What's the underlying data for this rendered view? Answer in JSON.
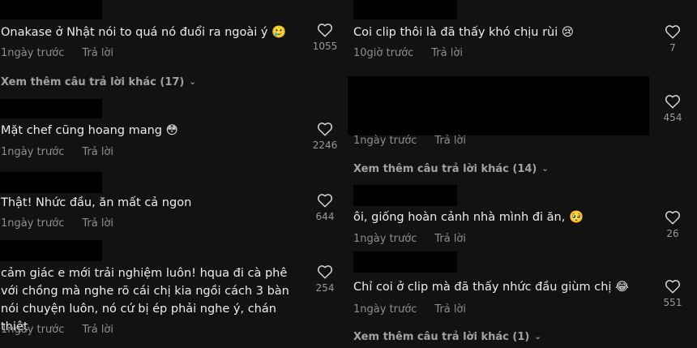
{
  "left_column": {
    "comments": [
      {
        "text": "Onakase ở Nhật nói to quá nó đuổi ra ngoài ý 🥲",
        "time": "1ngày trước",
        "reply": "Trả lời",
        "likes": "1055"
      },
      {
        "text": "Mặt chef cũng hoang mang 😳",
        "time": "1ngày trước",
        "reply": "Trả lời",
        "likes": "2246"
      },
      {
        "text": "Thật! Nhức đầu, ăn mất cả ngon",
        "time": "1ngày trước",
        "reply": "Trả lời",
        "likes": "644"
      },
      {
        "text": "cảm giác e mới trải nghiệm luôn! hqua đi cà phê với chồng mà nghe rõ cái chị kia ngồi cách 3 bàn nói chuyện luôn, nó cứ bị ép phải nghe ý, chán thiệt",
        "time": "1ngày trước",
        "reply": "Trả lời",
        "likes": "254"
      }
    ],
    "more_replies": "Xem thêm câu trả lời khác (17)"
  },
  "right_column": {
    "comments": [
      {
        "text": "Coi clip thôi là đã thấy khó chịu rùi 😢",
        "time": "10giờ trước",
        "reply": "Trả lời",
        "likes": "7"
      },
      {
        "text": "",
        "time": "1ngày trước",
        "reply": "Trả lời",
        "likes": "454"
      },
      {
        "text": "ôi, giống hoàn cảnh nhà mình đi ăn, 🥺",
        "time": "1ngày trước",
        "reply": "Trả lời",
        "likes": "26"
      },
      {
        "text": "Chỉ coi ở clip mà đã thấy nhức đầu giùm chị 😂",
        "time": "1ngày trước",
        "reply": "Trả lời",
        "likes": "551"
      }
    ],
    "more_replies_1": "Xem thêm câu trả lời khác (14)",
    "more_replies_2": "Xem thêm câu trả lời khác (1)"
  },
  "icons": {
    "like": "heart-outline-icon",
    "expand": "chevron-down-icon"
  },
  "colors": {
    "background": "#121212",
    "text": "#ececec",
    "muted": "#8e8e8e",
    "redaction": "#000000"
  }
}
